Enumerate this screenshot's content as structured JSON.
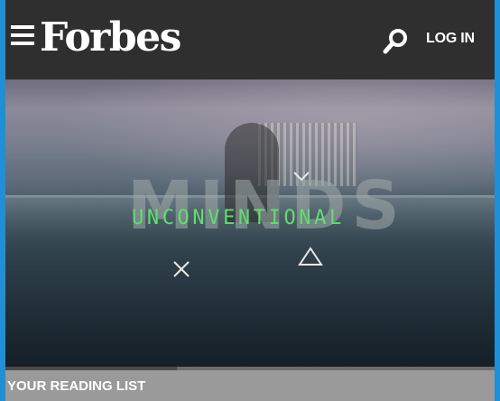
{
  "header": {
    "logo_text": "Forbes",
    "login_label": "LOG IN",
    "menu_icon": "hamburger-menu-icon",
    "search_icon": "search-icon"
  },
  "hero": {
    "background_word": "MINDS",
    "title": "UNCONVENTIONAL",
    "title_color": "#5ee06a",
    "icons": [
      "chevron-down-icon",
      "close-icon",
      "triangle-icon"
    ]
  },
  "reading_list": {
    "label": "YOUR READING LIST",
    "progress": 0.35
  },
  "colors": {
    "frame_accent": "#1f8fd6",
    "header_bg": "#2f2f2f",
    "reading_bg": "#9a9a9a"
  }
}
